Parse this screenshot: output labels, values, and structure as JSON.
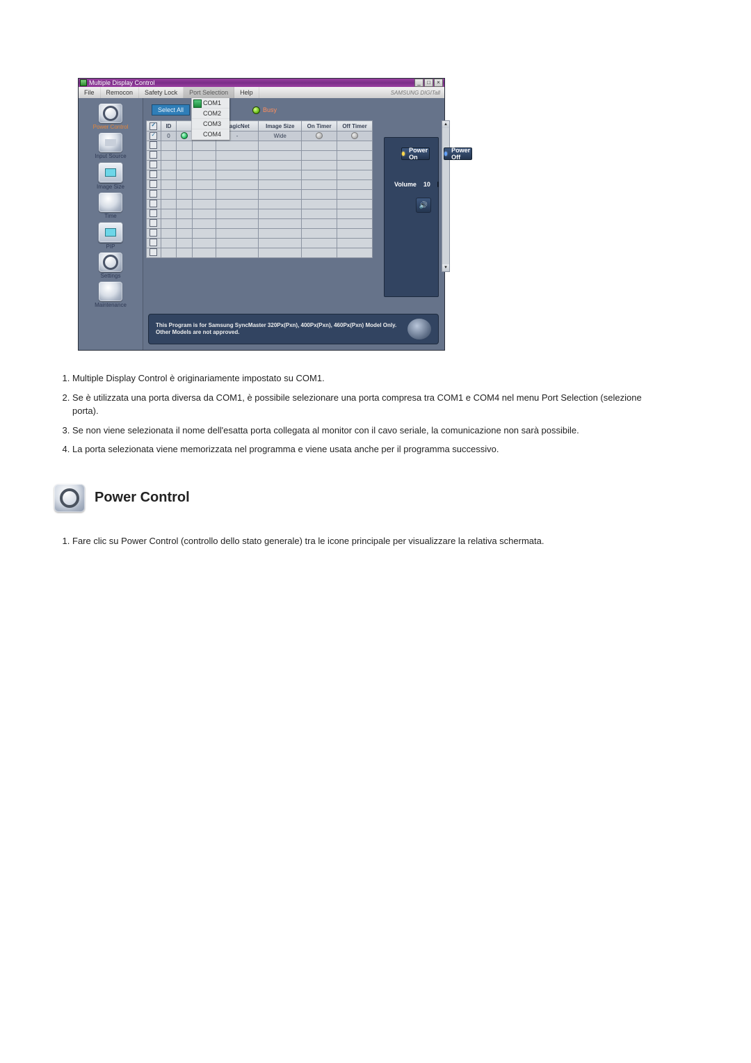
{
  "app": {
    "window_title": "Multiple Display Control",
    "brand": "SAMSUNG DIGITall",
    "menu": {
      "file": "File",
      "remocon": "Remocon",
      "safety_lock": "Safety Lock",
      "port_selection": "Port Selection",
      "help": "Help"
    },
    "port_dropdown": {
      "options": [
        "COM1",
        "COM2",
        "COM3",
        "COM4"
      ],
      "selected_index": 0
    },
    "sidebar": {
      "items": [
        {
          "label": "Power Control",
          "active": true
        },
        {
          "label": "Input Source"
        },
        {
          "label": "Image Size"
        },
        {
          "label": "Time"
        },
        {
          "label": "PIP"
        },
        {
          "label": "Settings"
        },
        {
          "label": "Maintenance"
        }
      ]
    },
    "toolbar": {
      "select_all": "Select All",
      "busy": "Busy"
    },
    "table": {
      "headers": {
        "chk": "",
        "id": "ID",
        "status": "",
        "conn": "..",
        "magicnet": "MagicNet",
        "imgsize": "Image Size",
        "ontimer": "On Timer",
        "offtimer": "Off Timer"
      },
      "row1": {
        "id": "0",
        "magicnet": "-",
        "imgsize": "Wide"
      }
    },
    "power_panel": {
      "on": "Power On",
      "off": "Power Off",
      "volume_label": "Volume",
      "volume_value": "10"
    },
    "footer": "This Program is for Samsung SyncMaster 320Px(Pxn), 400Px(Pxn), 460Px(Pxn)  Model Only. Other Models are not approved."
  },
  "doc": {
    "notes": [
      "Multiple Display Control è originariamente impostato su COM1.",
      "Se è utilizzata una porta diversa da COM1, è possibile selezionare una porta compresa tra COM1 e COM4 nel menu Port Selection (selezione porta).",
      "Se non viene selezionata il nome dell'esatta porta collegata al monitor con il cavo seriale, la comunicazione non sarà possibile.",
      "La porta selezionata viene memorizzata nel programma e viene usata anche per il programma successivo."
    ],
    "section_title": "Power Control",
    "steps": [
      "Fare clic su Power Control (controllo dello stato generale) tra le icone principale per visualizzare la relativa schermata."
    ]
  }
}
